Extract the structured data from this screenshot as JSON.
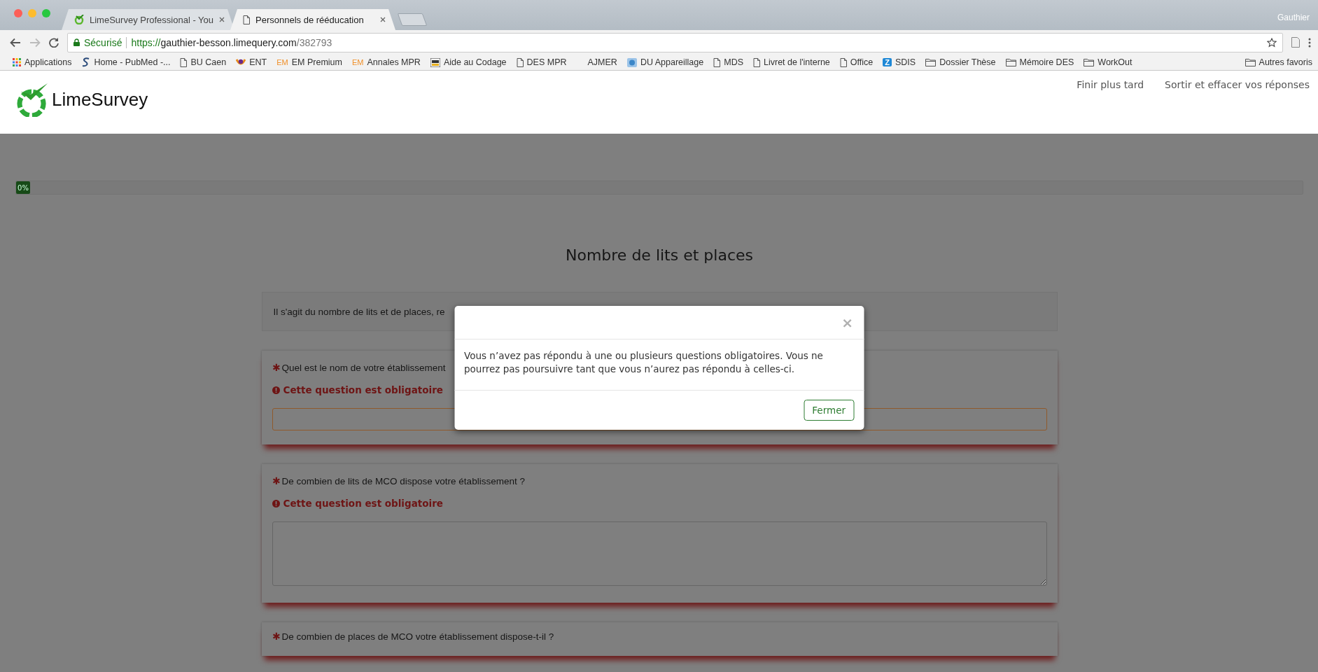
{
  "browser": {
    "tabs": [
      {
        "title": "LimeSurvey Professional - You",
        "selected": false
      },
      {
        "title": "Personnels de rééducation",
        "selected": true
      }
    ],
    "profile": "Gauthier",
    "address": {
      "secure_label": "Sécurisé",
      "scheme": "https://",
      "host": "gauthier-besson.limequery.com",
      "path": "/382793"
    },
    "bookmarks": [
      {
        "label": "Applications",
        "kind": "apps"
      },
      {
        "label": "Home - PubMed -...",
        "kind": "pubmed"
      },
      {
        "label": "BU Caen",
        "kind": "page"
      },
      {
        "label": "ENT",
        "kind": "ent"
      },
      {
        "label": "EM Premium",
        "kind": "letter",
        "badge": "EM",
        "color": "#f0902a"
      },
      {
        "label": "Annales MPR",
        "kind": "letter",
        "badge": "EM",
        "color": "#f0902a"
      },
      {
        "label": "Aide au Codage",
        "kind": "aac"
      },
      {
        "label": "DES MPR",
        "kind": "page"
      },
      {
        "label": "AJMER",
        "kind": "plain"
      },
      {
        "label": "DU Appareillage",
        "kind": "du"
      },
      {
        "label": "MDS",
        "kind": "page"
      },
      {
        "label": "Livret de l'interne",
        "kind": "page"
      },
      {
        "label": "Office",
        "kind": "page"
      },
      {
        "label": "SDIS",
        "kind": "letter",
        "badge": "Z",
        "color": "#1e88d6"
      },
      {
        "label": "Dossier Thèse",
        "kind": "folder"
      },
      {
        "label": "Mémoire DES",
        "kind": "folder"
      },
      {
        "label": "WorkOut",
        "kind": "folder"
      }
    ],
    "other_bookmarks": "Autres favoris"
  },
  "header": {
    "logo_text": "LimeSurvey",
    "links": [
      "Finir plus tard",
      "Sortir et effacer vos réponses"
    ]
  },
  "progress": {
    "level": 0,
    "label": "0%"
  },
  "group_title": "Nombre de lits et places",
  "description": "Il s'agit du nombre de lits et de places, re",
  "questions": [
    {
      "mark": "✱",
      "text": "Quel est le nom de votre établissement",
      "error": "Cette question est obligatoire",
      "kind": "short"
    },
    {
      "mark": "✱",
      "text": "De combien de lits de MCO dispose votre établissement ?",
      "error": "Cette question est obligatoire",
      "kind": "long"
    },
    {
      "mark": "✱",
      "text": "De combien de places de MCO votre établissement dispose-t-il ?",
      "kind": "cut"
    }
  ],
  "modal": {
    "close": "×",
    "message": "Vous n’avez pas répondu à une ou plusieurs questions obligatoires. Vous ne pourrez pas poursuivre tant que vous n’aurez pas répondu à celles-ci.",
    "button": "Fermer"
  }
}
